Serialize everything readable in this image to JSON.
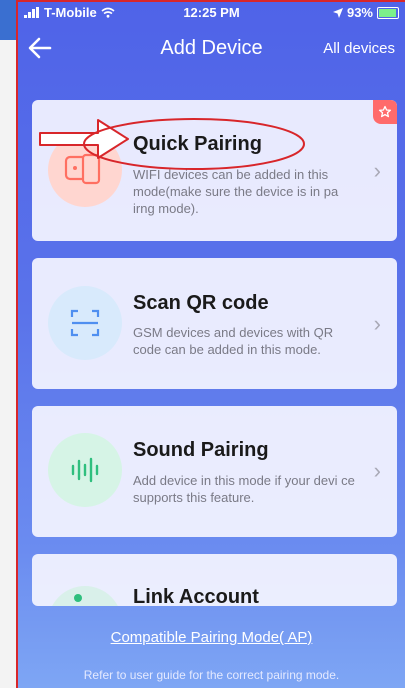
{
  "status": {
    "carrier": "T-Mobile",
    "time": "12:25 PM",
    "battery": "93%"
  },
  "header": {
    "title": "Add Device",
    "right_action": "All devices"
  },
  "cards": [
    {
      "title": "Quick Pairing",
      "desc": "WIFI devices can be added in this mode(make sure the device is in pa irng mode).",
      "icon": "phone-pairing-icon"
    },
    {
      "title": "Scan QR code",
      "desc": "GSM devices and devices with QR code can be added in this mode.",
      "icon": "qr-scan-icon"
    },
    {
      "title": "Sound Pairing",
      "desc": "Add device in this mode if your devi ce supports this feature.",
      "icon": "sound-wave-icon"
    },
    {
      "title": "Link Account",
      "desc": "",
      "icon": "link-account-icon"
    }
  ],
  "footer": {
    "link": "Compatible Pairing Mode( AP)",
    "note": "Refer to user guide for the correct pairing mode."
  },
  "colors": {
    "header_top": "#4f63e8",
    "header_bottom": "#7ea6f4",
    "annotation": "#d8262a"
  }
}
